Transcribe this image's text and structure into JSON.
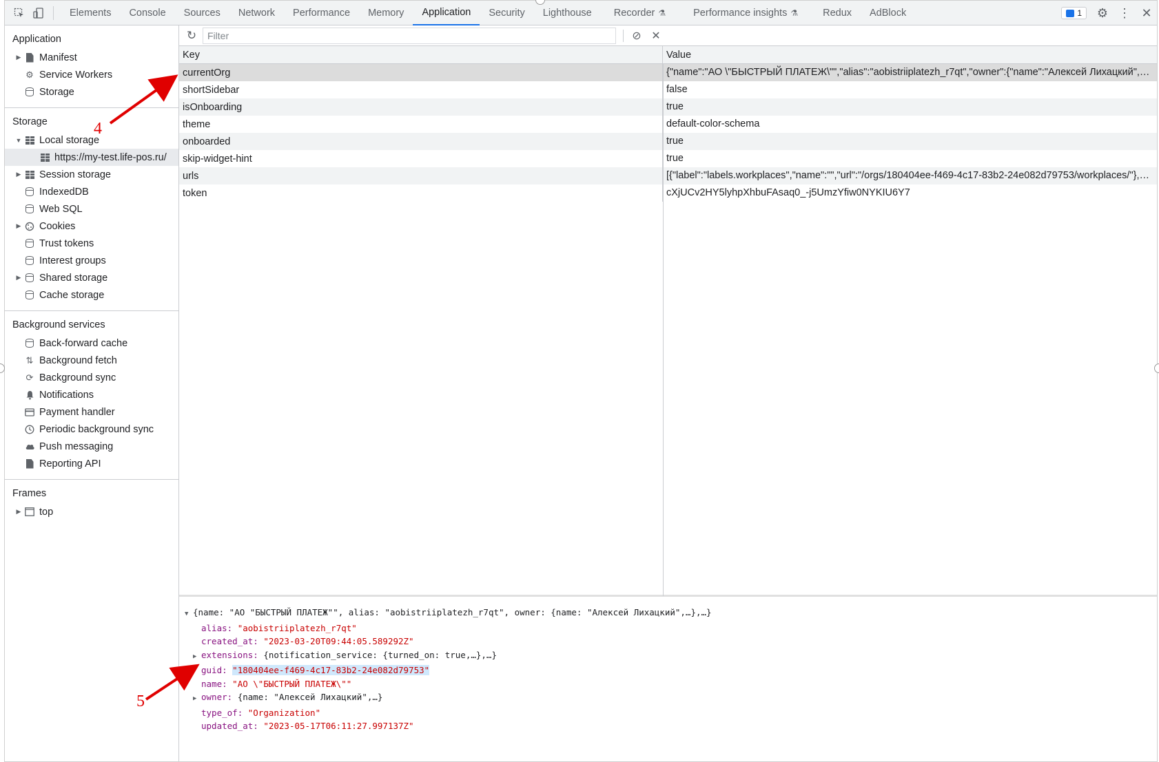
{
  "topbar": {
    "tabs": [
      {
        "label": "Elements"
      },
      {
        "label": "Console"
      },
      {
        "label": "Sources"
      },
      {
        "label": "Network"
      },
      {
        "label": "Performance"
      },
      {
        "label": "Memory"
      },
      {
        "label": "Application",
        "active": true
      },
      {
        "label": "Security"
      },
      {
        "label": "Lighthouse"
      },
      {
        "label": "Recorder",
        "experimental": true
      },
      {
        "label": "Performance insights",
        "experimental": true
      },
      {
        "label": "Redux"
      },
      {
        "label": "AdBlock"
      }
    ],
    "issues_count": "1",
    "accent_color": "#1a73e8"
  },
  "sidebar": {
    "application": {
      "title": "Application",
      "items": [
        "Manifest",
        "Service Workers",
        "Storage"
      ]
    },
    "storage": {
      "title": "Storage",
      "local_storage": "Local storage",
      "local_origin": "https://my-test.life-pos.ru/",
      "items": [
        "Session storage",
        "IndexedDB",
        "Web SQL",
        "Cookies",
        "Trust tokens",
        "Interest groups",
        "Shared storage",
        "Cache storage"
      ]
    },
    "background": {
      "title": "Background services",
      "items": [
        "Back-forward cache",
        "Background fetch",
        "Background sync",
        "Notifications",
        "Payment handler",
        "Periodic background sync",
        "Push messaging",
        "Reporting API"
      ]
    },
    "frames": {
      "title": "Frames",
      "items": [
        "top"
      ]
    }
  },
  "filter": {
    "placeholder": "Filter",
    "value": ""
  },
  "table": {
    "headers": {
      "key": "Key",
      "value": "Value"
    },
    "rows": [
      {
        "key": "currentOrg",
        "value": "{\"name\":\"АО \\\"БЫСТРЫЙ ПЛАТЕЖ\\\"\",\"alias\":\"aobistriiplatezh_r7qt\",\"owner\":{\"name\":\"Алексей Лихацкий\",\"r...",
        "selected": true
      },
      {
        "key": "shortSidebar",
        "value": "false"
      },
      {
        "key": "isOnboarding",
        "value": "true"
      },
      {
        "key": "theme",
        "value": "default-color-schema"
      },
      {
        "key": "onboarded",
        "value": "true"
      },
      {
        "key": "skip-widget-hint",
        "value": "true"
      },
      {
        "key": "urls",
        "value": "[{\"label\":\"labels.workplaces\",\"name\":\"\",\"url\":\"/orgs/180404ee-f469-4c17-83b2-24e082d79753/workplaces/\"},{\"..."
      },
      {
        "key": "token",
        "value": "cXjUCv2HY5lyhpXhbuFAsaq0_-j5UmzYfiw0NYKIU6Y7"
      }
    ]
  },
  "preview": {
    "summary": "{name: \"АО \"БЫСТРЫЙ ПЛАТЕЖ\"\", alias: \"aobistriiplatezh_r7qt\", owner: {name: \"Алексей Лихацкий\",…},…}",
    "props": [
      {
        "key": "alias",
        "value": "\"aobistriiplatezh_r7qt\"",
        "type": "string"
      },
      {
        "key": "created_at",
        "value": "\"2023-03-20T09:44:05.589292Z\"",
        "type": "string"
      },
      {
        "key": "extensions",
        "value": "{notification_service: {turned_on: true,…},…}",
        "type": "object"
      },
      {
        "key": "guid",
        "value": "\"180404ee-f469-4c17-83b2-24e082d79753\"",
        "type": "string",
        "highlighted": true
      },
      {
        "key": "name",
        "value": "\"АО \\\"БЫСТРЫЙ ПЛАТЕЖ\\\"\"",
        "type": "string"
      },
      {
        "key": "owner",
        "value": "{name: \"Алексей Лихацкий\",…}",
        "type": "object"
      },
      {
        "key": "type_of",
        "value": "\"Organization\"",
        "type": "string"
      },
      {
        "key": "updated_at",
        "value": "\"2023-05-17T06:11:27.997137Z\"",
        "type": "string"
      }
    ]
  },
  "annotations": {
    "label_4": "4",
    "label_5": "5",
    "color": "#e00000"
  }
}
